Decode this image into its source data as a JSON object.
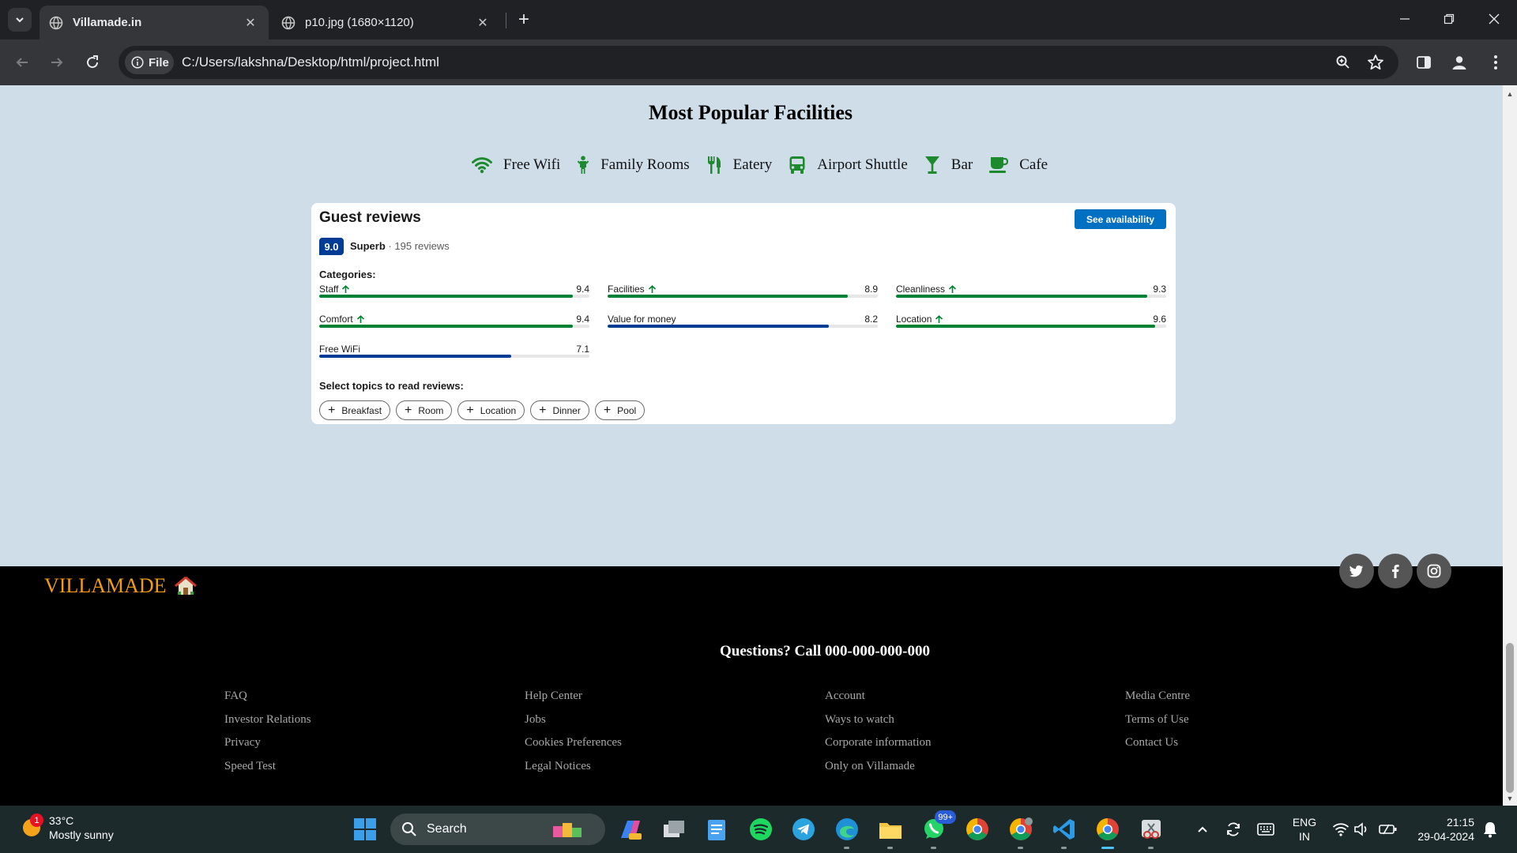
{
  "browser": {
    "tabs": [
      {
        "title": "Villamade.in",
        "active": true
      },
      {
        "title": "p10.jpg (1680×1120)",
        "active": false
      }
    ],
    "chip_label": "File",
    "url": "C:/Users/lakshna/Desktop/html/project.html"
  },
  "page": {
    "title": "Most Popular Facilities",
    "facilities": [
      {
        "label": "Free Wifi",
        "icon": "wifi-icon"
      },
      {
        "label": "Family Rooms",
        "icon": "family-icon"
      },
      {
        "label": "Eatery",
        "icon": "utensils-icon"
      },
      {
        "label": "Airport Shuttle",
        "icon": "bus-icon"
      },
      {
        "label": "Bar",
        "icon": "cocktail-icon"
      },
      {
        "label": "Cafe",
        "icon": "coffee-icon"
      }
    ]
  },
  "reviews": {
    "title": "Guest reviews",
    "button_label": "See availability",
    "score": "9.0",
    "rating_word": "Superb",
    "separator": "·",
    "count_text": "195 reviews",
    "categories_heading": "Categories:",
    "categories": [
      {
        "label": "Staff",
        "value": "9.4",
        "score": 9.4,
        "trend_up": true,
        "color": "#008234"
      },
      {
        "label": "Facilities",
        "value": "8.9",
        "score": 8.9,
        "trend_up": true,
        "color": "#008234"
      },
      {
        "label": "Cleanliness",
        "value": "9.3",
        "score": 9.3,
        "trend_up": true,
        "color": "#008234"
      },
      {
        "label": "Comfort",
        "value": "9.4",
        "score": 9.4,
        "trend_up": true,
        "color": "#008234"
      },
      {
        "label": "Value for money",
        "value": "8.2",
        "score": 8.2,
        "trend_up": false,
        "color": "#003b95"
      },
      {
        "label": "Location",
        "value": "9.6",
        "score": 9.6,
        "trend_up": true,
        "color": "#008234"
      },
      {
        "label": "Free WiFi",
        "value": "7.1",
        "score": 7.1,
        "trend_up": false,
        "color": "#003b95"
      }
    ],
    "topics_heading": "Select topics to read reviews:",
    "topics": [
      "Breakfast",
      "Room",
      "Location",
      "Dinner",
      "Pool"
    ]
  },
  "footer": {
    "brand": "VILLAMADE",
    "phone": "Questions? Call 000-000-000-000",
    "columns": [
      [
        "FAQ",
        "Investor Relations",
        "Privacy",
        "Speed Test"
      ],
      [
        "Help Center",
        "Jobs",
        "Cookies Preferences",
        "Legal Notices"
      ],
      [
        "Account",
        "Ways to watch",
        "Corporate information",
        "Only on Villamade"
      ],
      [
        "Media Centre",
        "Terms of Use",
        "Contact Us"
      ]
    ],
    "social": [
      "twitter-icon",
      "facebook-icon",
      "instagram-icon"
    ]
  },
  "taskbar": {
    "weather_temp": "33°C",
    "weather_desc": "Mostly sunny",
    "weather_badge": "1",
    "search_label": "Search",
    "whatsapp_badge": "99+",
    "lang_line1": "ENG",
    "lang_line2": "IN",
    "time": "21:15",
    "date": "29-04-2024"
  }
}
